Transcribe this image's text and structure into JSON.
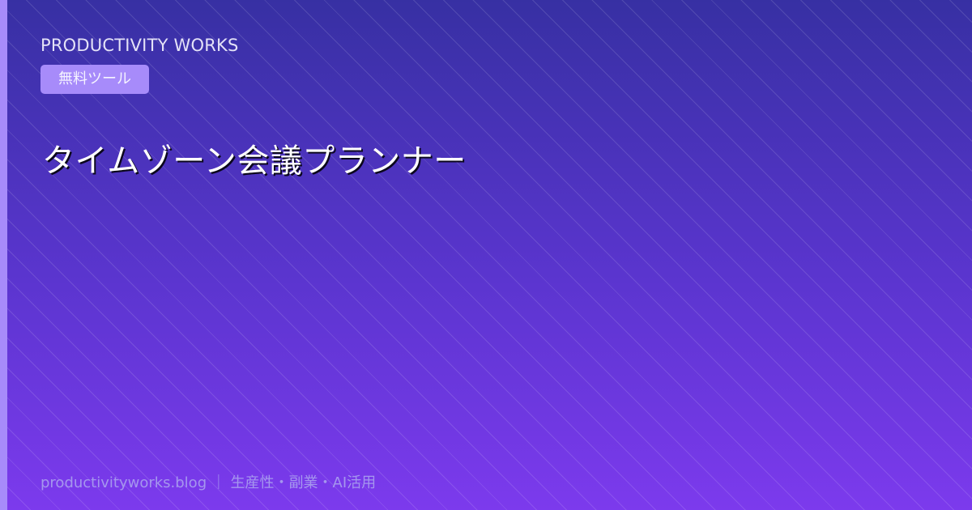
{
  "card": {
    "brand": "PRODUCTIVITY WORKS",
    "badge": "無料ツール",
    "title": "タイムゾーン会議プランナー",
    "footer": "productivityworks.blog ｜ 生産性・副業・AI活用"
  },
  "colors": {
    "gradient_top": "#3730a3",
    "gradient_bottom": "#7c3aed",
    "accent": "#a78bfa",
    "title_text": "#ffffff",
    "footer_text": "#a596ee"
  }
}
